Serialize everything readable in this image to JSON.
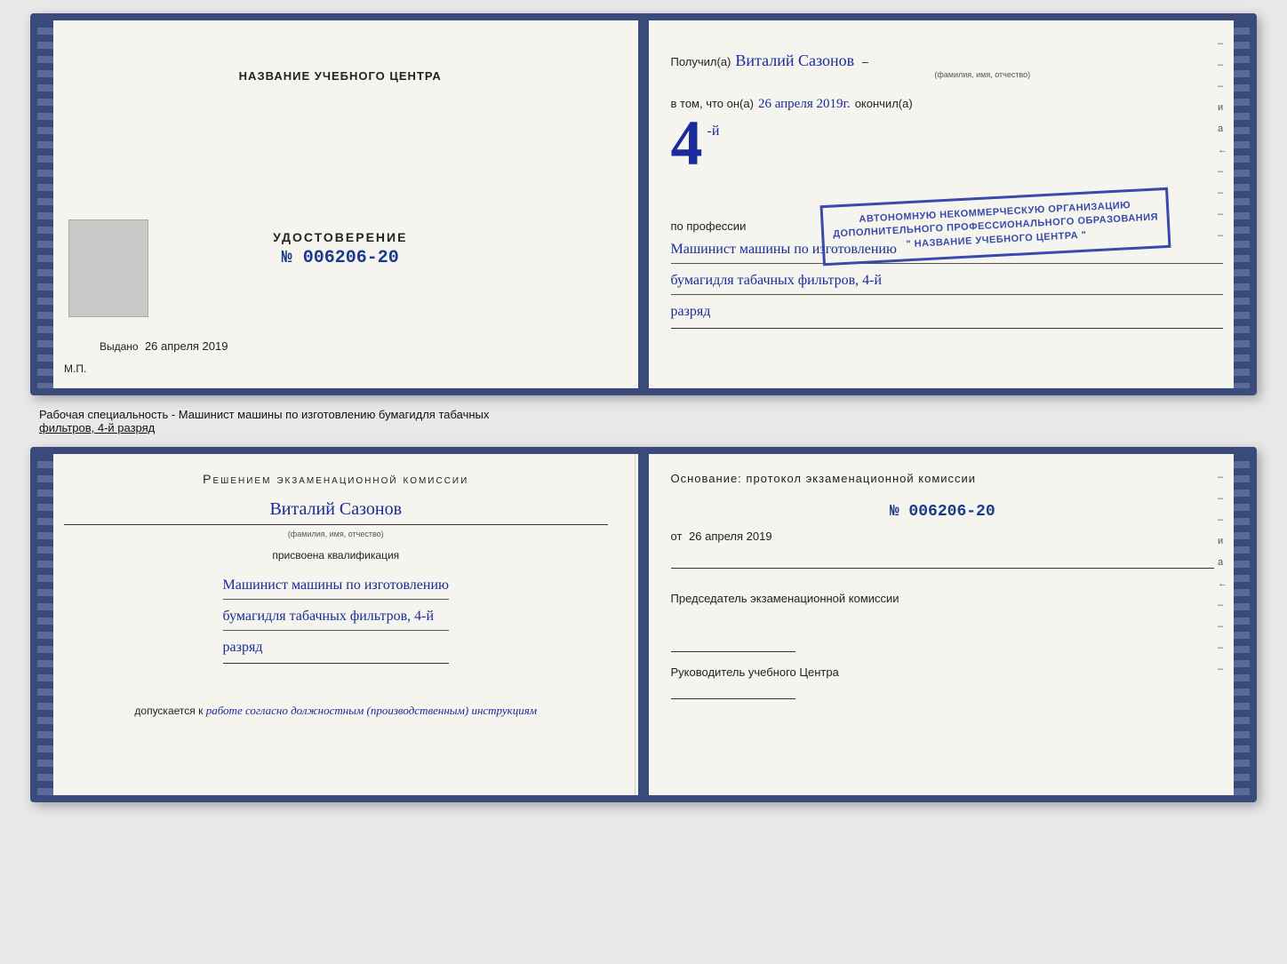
{
  "top_cert": {
    "left": {
      "center_title": "НАЗВАНИЕ УЧЕБНОГО ЦЕНТРА",
      "cert_label": "УДОСТОВЕРЕНИЕ",
      "cert_number": "№ 006206-20",
      "issued_prefix": "Выдано",
      "issued_date": "26 апреля 2019",
      "mp_label": "М.П."
    },
    "right": {
      "recipient_prefix": "Получил(а)",
      "recipient_name": "Виталий Сазонов",
      "recipient_caption": "(фамилия, имя, отчество)",
      "vtom_prefix": "в том, что он(а)",
      "vtom_date": "26 апреля 2019г.",
      "okончил_label": "окончил(а)",
      "stamp_line1": "АВТОНОМНУЮ НЕКОММЕРЧЕСКУЮ ОРГАНИЗАЦИЮ",
      "stamp_line2": "ДОПОЛНИТЕЛЬНОГО ПРОФЕССИОНАЛЬНОГО ОБРАЗОВАНИЯ",
      "stamp_line3": "\" НАЗВАНИЕ УЧЕБНОГО ЦЕНТРА \"",
      "profession_prefix": "по профессии",
      "profession_line1": "Машинист машины по изготовлению",
      "profession_line2": "бумагидля табачных фильтров, 4-й",
      "profession_line3": "разряд",
      "side_dashes": [
        "-",
        "-",
        "-",
        "и",
        "а",
        "←",
        "-",
        "-",
        "-",
        "-",
        "-"
      ]
    }
  },
  "info_strip": {
    "text_prefix": "Рабочая специальность - Машинист машины по изготовлению бумагидля табачных",
    "text_underline": "фильтров, 4-й разряд"
  },
  "bottom_cert": {
    "left": {
      "komissia_title": "Решением экзаменационной комиссии",
      "person_name": "Виталий Сазонов",
      "person_caption": "(фамилия, имя, отчество)",
      "assigned_label": "присвоена квалификация",
      "qualification_line1": "Машинист машины по изготовлению",
      "qualification_line2": "бумагидля табачных фильтров, 4-й",
      "qualification_line3": "разряд",
      "dopuskaetsya_prefix": "допускается к",
      "dopuskaetsya_text": "работе согласно должностным (производственным) инструкциям"
    },
    "right": {
      "osnovanye_label": "Основание: протокол экзаменационной комиссии",
      "protocol_number": "№ 006206-20",
      "ot_prefix": "от",
      "ot_date": "26 апреля 2019",
      "predsedatel_label": "Председатель экзаменационной комиссии",
      "rukovoditel_label": "Руководитель учебного Центра",
      "side_dashes": [
        "-",
        "-",
        "-",
        "и",
        "а",
        "←",
        "-",
        "-",
        "-",
        "-",
        "-"
      ]
    }
  }
}
